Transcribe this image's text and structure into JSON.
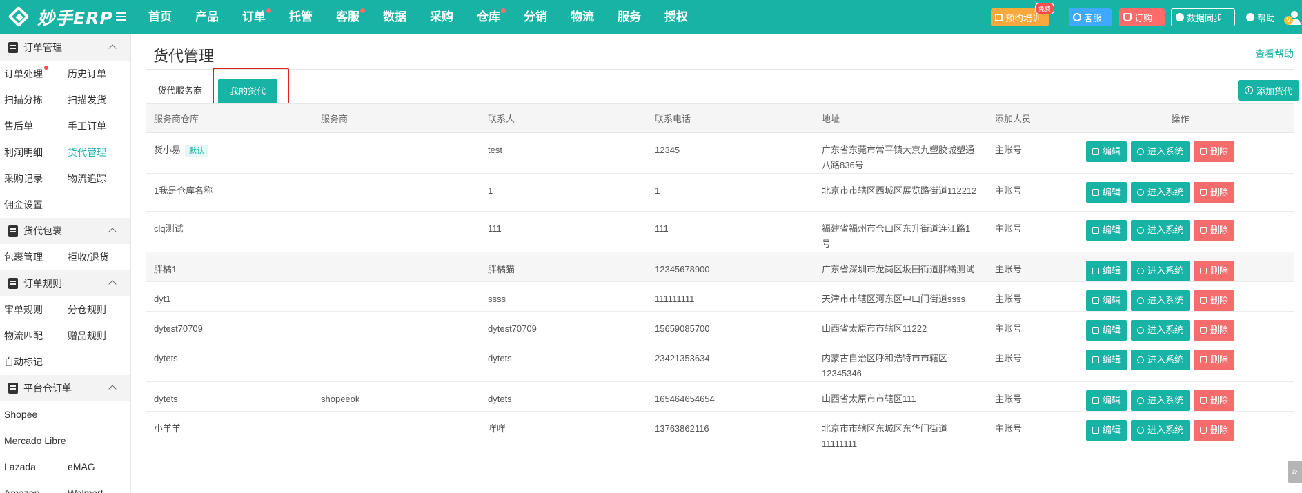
{
  "app": {
    "logo_text": "妙手ERP"
  },
  "nav": [
    {
      "label": "首页",
      "dot": false
    },
    {
      "label": "产品",
      "dot": false
    },
    {
      "label": "订单",
      "dot": true
    },
    {
      "label": "托管",
      "dot": false
    },
    {
      "label": "客服",
      "dot": true
    },
    {
      "label": "数据",
      "dot": false
    },
    {
      "label": "采购",
      "dot": false
    },
    {
      "label": "仓库",
      "dot": true
    },
    {
      "label": "分销",
      "dot": false
    },
    {
      "label": "物流",
      "dot": false
    },
    {
      "label": "服务",
      "dot": false
    },
    {
      "label": "授权",
      "dot": false
    }
  ],
  "top_right": {
    "training": "预约培训",
    "training_badge": "免费",
    "cs": "客服",
    "buy": "订购",
    "sync": "数据同步",
    "help": "帮助",
    "avatar_badge": "V"
  },
  "sidebar": {
    "groups": [
      {
        "title": "订单管理",
        "rows": [
          [
            {
              "label": "订单处理",
              "dot": true
            },
            {
              "label": "历史订单"
            }
          ],
          [
            {
              "label": "扫描分拣"
            },
            {
              "label": "扫描发货"
            }
          ],
          [
            {
              "label": "售后单"
            },
            {
              "label": "手工订单"
            }
          ],
          [
            {
              "label": "利润明细"
            },
            {
              "label": "货代管理",
              "active": true
            }
          ],
          [
            {
              "label": "采购记录"
            },
            {
              "label": "物流追踪"
            }
          ],
          [
            {
              "label": "佣金设置"
            }
          ]
        ]
      },
      {
        "title": "货代包裹",
        "rows": [
          [
            {
              "label": "包裹管理"
            },
            {
              "label": "拒收/退货"
            }
          ]
        ]
      },
      {
        "title": "订单规则",
        "rows": [
          [
            {
              "label": "审单规则"
            },
            {
              "label": "分仓规则"
            }
          ],
          [
            {
              "label": "物流匹配"
            },
            {
              "label": "赠品规则"
            }
          ],
          [
            {
              "label": "自动标记"
            }
          ]
        ]
      },
      {
        "title": "平台仓订单",
        "rows": [
          [
            {
              "label": "Shopee"
            }
          ],
          [
            {
              "label": "Mercado Libre"
            }
          ],
          [
            {
              "label": "Lazada"
            },
            {
              "label": "eMAG"
            }
          ],
          [
            {
              "label": "Amazon"
            },
            {
              "label": "Walmart"
            }
          ]
        ]
      }
    ]
  },
  "main": {
    "title": "货代管理",
    "help_link": "查看帮助",
    "tabs": [
      {
        "label": "货代服务商",
        "active": false
      },
      {
        "label": "我的货代",
        "active": true
      }
    ],
    "add_button": "添加货代",
    "columns": [
      "服务商仓库",
      "服务商",
      "联系人",
      "联系电话",
      "地址",
      "添加人员",
      "操作"
    ],
    "actions": {
      "edit": "编辑",
      "enter": "进入系统",
      "delete": "删除"
    },
    "rows": [
      {
        "warehouse": "货小易",
        "default_badge": "默认",
        "provider": "",
        "contact": "test",
        "phone": "12345",
        "address": "广东省东莞市常平镇大京九塑胶城塑通八路836号",
        "creator": "主账号"
      },
      {
        "warehouse": "1我是仓库名称",
        "provider": "",
        "contact": "1",
        "phone": "1",
        "address": "北京市市辖区西城区展览路街道112212",
        "creator": "主账号"
      },
      {
        "warehouse": "clq测试",
        "provider": "",
        "contact": "111",
        "phone": "111",
        "address": "福建省福州市仓山区东升街道连江路1号",
        "creator": "主账号"
      },
      {
        "warehouse": "胖橘1",
        "provider": "",
        "contact": "胖橘猫",
        "phone": "12345678900",
        "address": "广东省深圳市龙岗区坂田街道胖橘测试",
        "creator": "主账号",
        "hover": true
      },
      {
        "warehouse": "dyt1",
        "provider": "",
        "contact": "ssss",
        "phone": "111111111",
        "address": "天津市市辖区河东区中山门街道ssss",
        "creator": "主账号"
      },
      {
        "warehouse": "dytest70709",
        "provider": "",
        "contact": "dytest70709",
        "phone": "15659085700",
        "address": "山西省太原市市辖区11222",
        "creator": "主账号"
      },
      {
        "warehouse": "dytets",
        "provider": "",
        "contact": "dytets",
        "phone": "23421353634",
        "address": "内蒙古自治区呼和浩特市市辖区12345346",
        "creator": "主账号"
      },
      {
        "warehouse": "dytets",
        "provider": "shopeeok",
        "contact": "dytets",
        "phone": "165464654654",
        "address": "山西省太原市市辖区111",
        "creator": "主账号"
      },
      {
        "warehouse": "小羊羊",
        "provider": "",
        "contact": "咩咩",
        "phone": "13763862116",
        "address": "北京市市辖区东城区东华门街道11111111",
        "creator": "主账号"
      }
    ]
  },
  "icons": {
    "menu": "hamburger-icon",
    "group": "clipboard-icon",
    "collapse": "chevron-up-icon",
    "scroll": "double-chevron-right-icon"
  },
  "colors": {
    "primary": "#17b3a5",
    "danger": "#f56c6c",
    "highlight": "#e02020"
  },
  "scroll_fab": "»"
}
